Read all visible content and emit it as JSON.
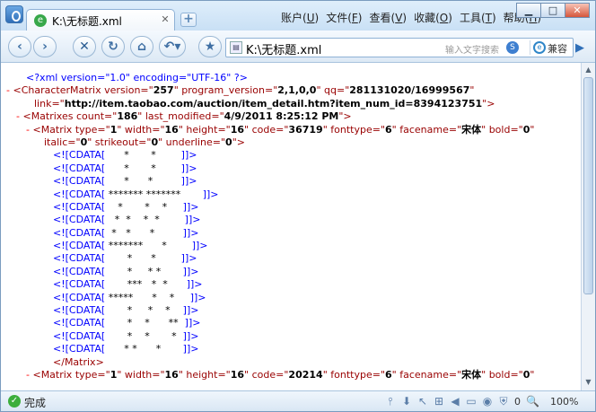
{
  "window": {
    "tab_title": "K:\\无标题.xml",
    "menus": [
      {
        "label": "账户",
        "key": "U"
      },
      {
        "label": "文件",
        "key": "F"
      },
      {
        "label": "查看",
        "key": "V"
      },
      {
        "label": "收藏",
        "key": "O"
      },
      {
        "label": "工具",
        "key": "T"
      },
      {
        "label": "帮助",
        "key": "H"
      }
    ],
    "controls": {
      "minimize": "▁",
      "maximize": "□",
      "close": "✕"
    }
  },
  "toolbar": {
    "address": "K:\\无标题.xml",
    "search_placeholder": "输入文字搜索",
    "compat_label": "兼容",
    "icons": [
      "back-icon",
      "forward-icon",
      "stop-icon",
      "refresh-icon",
      "home-icon",
      "undo-icon",
      "favorite-star-icon"
    ]
  },
  "xml": {
    "decl": {
      "text": "<?xml version=\"1.0\" encoding=\"UTF-16\" ?>"
    },
    "charmatrix": {
      "tag": "CharacterMatrix",
      "version": "257",
      "program_version": "2,1,0,0",
      "qq": "281131020/16999567",
      "link": "http://item.taobao.com/auction/item_detail.htm?item_num_id=8394123751"
    },
    "matrixes": {
      "tag": "Matrixes",
      "count": "186",
      "last_modified": "4/9/2011 8:25:12 PM"
    },
    "matrix1": {
      "tag": "Matrix",
      "type": "1",
      "width": "16",
      "height": "16",
      "code": "36719",
      "fonttype": "6",
      "facename": "宋体",
      "bold": "0",
      "italic": "0",
      "strikeout": "0",
      "underline": "0"
    },
    "cdata_rows": [
      "      *       *        ",
      "      *       *        ",
      "      *      *         ",
      " ******* *******       ",
      "    *       *    *     ",
      "   *  *    *  *        ",
      "  *   *      *         ",
      " *******      *        ",
      "       *      *        ",
      "       *     * *       ",
      "       ***   *  *      ",
      " *****      *    *     ",
      "       *     *    *    ",
      "       *    *      **  ",
      "       *    *       *  ",
      "      * *      *       "
    ],
    "matrix1_close": "Matrix",
    "matrix2": {
      "tag": "Matrix",
      "type": "1",
      "width": "16",
      "height": "16",
      "code": "20214",
      "fonttype": "6",
      "facename": "宋体",
      "bold": "0"
    }
  },
  "status": {
    "text": "完成",
    "counter": "0",
    "zoom": "100%"
  }
}
